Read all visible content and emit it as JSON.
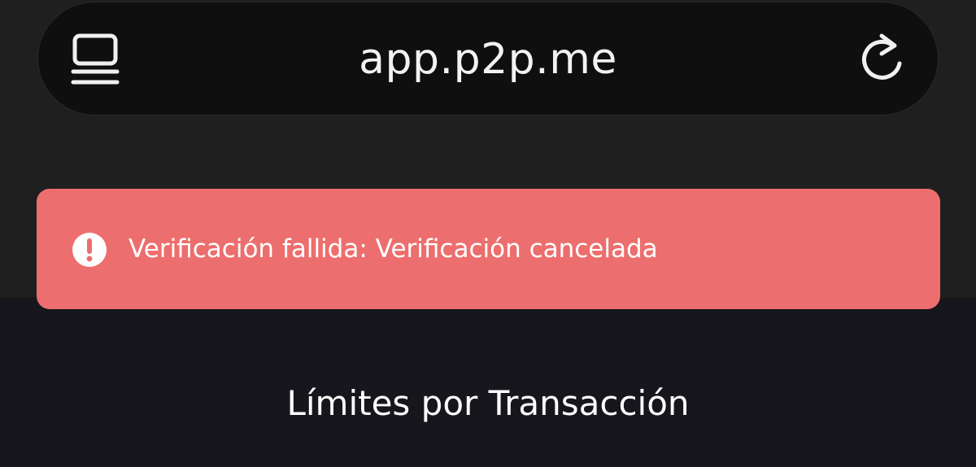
{
  "browser": {
    "url": "app.p2p.me",
    "tabs_icon": "tabs-list-icon",
    "reload_icon": "reload-icon"
  },
  "toast": {
    "icon": "exclamation-circle-icon",
    "message": "Verificación fallida: Verificación cancelada",
    "background_color": "#ed6e6e"
  },
  "main": {
    "section_title": "Límites por Transacción"
  }
}
